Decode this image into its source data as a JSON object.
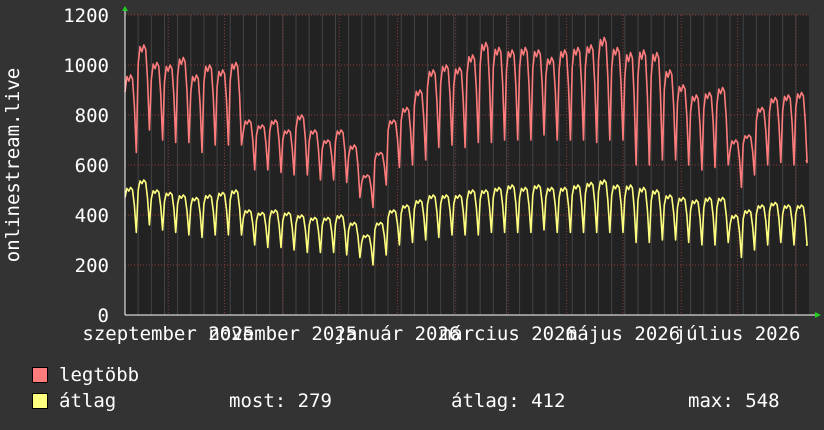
{
  "chart_data": {
    "type": "line",
    "ylabel": "onlinestream.live",
    "ylim": [
      0,
      1200
    ],
    "yticks": [
      0,
      200,
      400,
      600,
      800,
      1000,
      1200
    ],
    "x_start": "2025-08-09",
    "x_end": "2026-08-08",
    "xtick_labels": [
      {
        "label": "szeptember 2025",
        "date": "2025-09-01"
      },
      {
        "label": "november 2025",
        "date": "2025-11-01"
      },
      {
        "label": "január 2026",
        "date": "2026-01-01"
      },
      {
        "label": "március 2026",
        "date": "2026-03-01"
      },
      {
        "label": "május 2026",
        "date": "2026-05-01"
      },
      {
        "label": "július 2026",
        "date": "2026-07-01"
      }
    ],
    "grid": true,
    "legend_position": "bottom",
    "series": [
      {
        "name": "legtöbb",
        "color": "#ff7c7c",
        "weekly_dates": [
          "2025-08-09",
          "2025-08-16",
          "2025-08-23",
          "2025-08-30",
          "2025-09-06",
          "2025-09-13",
          "2025-09-20",
          "2025-09-27",
          "2025-10-04",
          "2025-10-11",
          "2025-10-18",
          "2025-10-25",
          "2025-11-01",
          "2025-11-08",
          "2025-11-15",
          "2025-11-22",
          "2025-11-29",
          "2025-12-06",
          "2025-12-13",
          "2025-12-20",
          "2025-12-27",
          "2026-01-03",
          "2026-01-10",
          "2026-01-17",
          "2026-01-24",
          "2026-01-31",
          "2026-02-07",
          "2026-02-14",
          "2026-02-21",
          "2026-02-28",
          "2026-03-07",
          "2026-03-14",
          "2026-03-21",
          "2026-03-28",
          "2026-04-04",
          "2026-04-11",
          "2026-04-18",
          "2026-04-25",
          "2026-05-02",
          "2026-05-09",
          "2026-05-16",
          "2026-05-23",
          "2026-05-30",
          "2026-06-06",
          "2026-06-13",
          "2026-06-20",
          "2026-06-27",
          "2026-07-04",
          "2026-07-11",
          "2026-07-18",
          "2026-07-25",
          "2026-08-01"
        ],
        "weekly_peak": [
          960,
          1080,
          1010,
          1000,
          1030,
          960,
          1000,
          980,
          1010,
          780,
          760,
          780,
          740,
          800,
          740,
          700,
          740,
          680,
          560,
          650,
          780,
          830,
          900,
          980,
          1000,
          990,
          1040,
          1090,
          1070,
          1060,
          1070,
          1060,
          1030,
          1060,
          1070,
          1080,
          1110,
          1070,
          1050,
          1060,
          1050,
          980,
          920,
          880,
          890,
          910,
          700,
          720,
          830,
          870,
          880,
          890
        ],
        "weekly_trough": [
          650,
          740,
          700,
          690,
          690,
          650,
          680,
          680,
          680,
          580,
          580,
          570,
          560,
          560,
          540,
          540,
          530,
          470,
          430,
          520,
          590,
          600,
          620,
          670,
          680,
          670,
          690,
          690,
          700,
          700,
          700,
          720,
          700,
          700,
          700,
          690,
          700,
          700,
          600,
          600,
          620,
          620,
          600,
          580,
          590,
          600,
          510,
          560,
          600,
          610,
          600,
          610
        ],
        "last": 620
      },
      {
        "name": "átlag",
        "color": "#ffff80",
        "weekly_dates": [
          "2025-08-09",
          "2025-08-16",
          "2025-08-23",
          "2025-08-30",
          "2025-09-06",
          "2025-09-13",
          "2025-09-20",
          "2025-09-27",
          "2025-10-04",
          "2025-10-11",
          "2025-10-18",
          "2025-10-25",
          "2025-11-01",
          "2025-11-08",
          "2025-11-15",
          "2025-11-22",
          "2025-11-29",
          "2025-12-06",
          "2025-12-13",
          "2025-12-20",
          "2025-12-27",
          "2026-01-03",
          "2026-01-10",
          "2026-01-17",
          "2026-01-24",
          "2026-01-31",
          "2026-02-07",
          "2026-02-14",
          "2026-02-21",
          "2026-02-28",
          "2026-03-07",
          "2026-03-14",
          "2026-03-21",
          "2026-03-28",
          "2026-04-04",
          "2026-04-11",
          "2026-04-18",
          "2026-04-25",
          "2026-05-02",
          "2026-05-09",
          "2026-05-16",
          "2026-05-23",
          "2026-05-30",
          "2026-06-06",
          "2026-06-13",
          "2026-06-20",
          "2026-06-27",
          "2026-07-04",
          "2026-07-11",
          "2026-07-18",
          "2026-07-25",
          "2026-08-01"
        ],
        "weekly_peak": [
          510,
          540,
          500,
          490,
          480,
          470,
          480,
          490,
          500,
          420,
          410,
          420,
          410,
          400,
          390,
          390,
          400,
          370,
          320,
          370,
          420,
          440,
          460,
          480,
          480,
          480,
          500,
          500,
          510,
          520,
          510,
          520,
          510,
          510,
          520,
          530,
          540,
          520,
          520,
          510,
          500,
          480,
          470,
          460,
          470,
          470,
          400,
          420,
          440,
          450,
          440,
          440
        ],
        "weekly_trough": [
          330,
          360,
          340,
          330,
          320,
          310,
          320,
          320,
          320,
          280,
          270,
          270,
          260,
          250,
          250,
          250,
          240,
          230,
          200,
          240,
          280,
          290,
          300,
          310,
          320,
          320,
          320,
          330,
          330,
          330,
          330,
          340,
          330,
          330,
          330,
          330,
          330,
          330,
          290,
          290,
          300,
          300,
          290,
          280,
          280,
          290,
          230,
          260,
          280,
          290,
          280,
          280
        ],
        "last": 279
      }
    ]
  },
  "legend": {
    "max_label": "legtöbb",
    "avg_label": "átlag"
  },
  "stats": {
    "most": "most: 279",
    "atlag": "átlag: 412",
    "max": "max: 548"
  }
}
